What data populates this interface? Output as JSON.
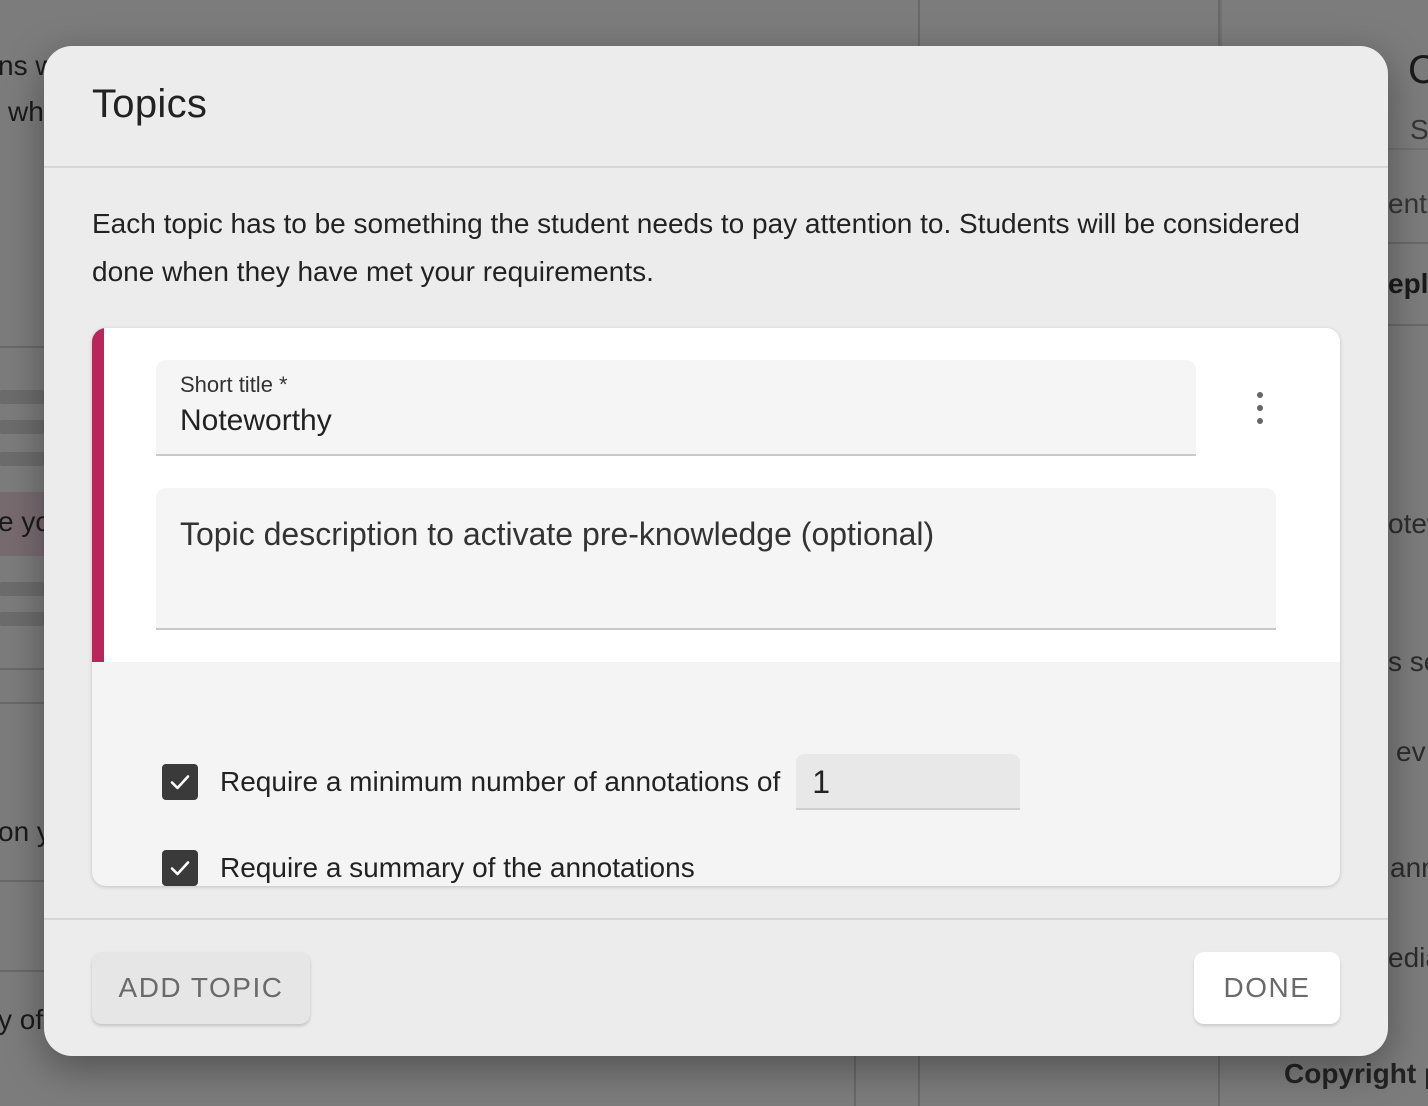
{
  "background": {
    "left_snippets": [
      "ns w",
      "wh",
      "e yo",
      "on y",
      "y of"
    ],
    "right_snippets": [
      "C",
      "S",
      "ent",
      "epla",
      "otew",
      "s se",
      "ev",
      "ann",
      "edia",
      "Copyright p"
    ]
  },
  "dialog": {
    "title": "Topics",
    "intro": "Each topic has to be something the student needs to pay attention to. Students will be considered done when they have met your requirements.",
    "topic": {
      "accent_color": "#b8265a",
      "short_title_label": "Short title *",
      "short_title_value": "Noteworthy",
      "description_placeholder": "Topic description to activate pre-knowledge (optional)",
      "options": {
        "min_annotations": {
          "checked": true,
          "label": "Require a minimum number of annotations of",
          "value": "1"
        },
        "require_summary": {
          "checked": true,
          "label": "Require a summary of the annotations"
        }
      }
    },
    "buttons": {
      "add_topic": "ADD TOPIC",
      "done": "DONE"
    }
  }
}
